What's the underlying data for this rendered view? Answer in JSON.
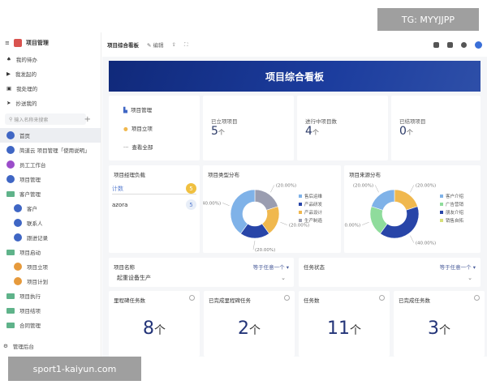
{
  "sidebar": {
    "app_title": "项目管理",
    "quick": [
      {
        "label": "我的待办",
        "icon": "bell-icon"
      },
      {
        "label": "我发起的",
        "icon": "play-icon"
      },
      {
        "label": "我处理的",
        "icon": "inbox-icon"
      },
      {
        "label": "抄送我的",
        "icon": "send-icon"
      }
    ],
    "search_placeholder": "输入名称来搜索",
    "items": [
      {
        "label": "首页",
        "color": "#3f66c4",
        "level": 0,
        "active": true
      },
      {
        "label": "简道云 项目管理「使用说明」",
        "color": "#3f66c4",
        "level": 0
      },
      {
        "label": "员工工作台",
        "color": "#9b4dca",
        "level": 0
      },
      {
        "label": "项目管理",
        "color": "#3f66c4",
        "level": 0
      },
      {
        "label": "客户管理",
        "folder": true,
        "level": 0
      },
      {
        "label": "客户",
        "color": "#3f66c4",
        "level": 1
      },
      {
        "label": "联系人",
        "color": "#3f66c4",
        "level": 1
      },
      {
        "label": "跟进记录",
        "color": "#3f66c4",
        "level": 1
      },
      {
        "label": "项目启动",
        "folder": true,
        "level": 0
      },
      {
        "label": "项目立项",
        "color": "#e69a3c",
        "level": 1
      },
      {
        "label": "项目计划",
        "color": "#e69a3c",
        "level": 1
      },
      {
        "label": "项目执行",
        "folder": true,
        "level": 0
      },
      {
        "label": "项目结项",
        "folder": true,
        "level": 0
      },
      {
        "label": "合同管理",
        "folder": true,
        "level": 0
      }
    ],
    "admin": "管理后台"
  },
  "topbar": {
    "title": "项目综合看板",
    "edit": "编辑"
  },
  "banner": "项目综合看板",
  "shortcuts": [
    "项目管理",
    "项目立项",
    "查看全部"
  ],
  "stats": [
    {
      "label": "已立项项目",
      "value": "5",
      "unit": "个"
    },
    {
      "label": "进行中项目数",
      "value": "4",
      "unit": "个"
    },
    {
      "label": "已结项项目",
      "value": "0",
      "unit": "个"
    }
  ],
  "load": {
    "title": "项目经理负载",
    "header": "计数",
    "header_badge": "5",
    "rows": [
      {
        "name": "azora",
        "value": "5"
      }
    ]
  },
  "chart_data": [
    {
      "type": "pie",
      "title": "项目类型分布",
      "donut": true,
      "categories": [
        "生产制造",
        "产品设计",
        "产品研发",
        "售后运维"
      ],
      "values": [
        20,
        20,
        20,
        40
      ],
      "labels": [
        "(20.00%)",
        "(20.00%)",
        "(20.00%)",
        "40.00%)"
      ],
      "colors": [
        "#9a9db0",
        "#f0b84e",
        "#2845a8",
        "#7fb2e8"
      ],
      "legend": [
        "售后运维",
        "产品研发",
        "产品设计",
        "生产制造"
      ],
      "legend_colors": [
        "#7fb2e8",
        "#2845a8",
        "#f0b84e",
        "#9a9db0"
      ],
      "legend_position": "right"
    },
    {
      "type": "pie",
      "title": "项目来源分布",
      "donut": true,
      "categories": [
        "销售自拓",
        "朋友介绍",
        "广告营销",
        "客户介绍"
      ],
      "values": [
        20,
        40,
        20,
        20
      ],
      "labels": [
        "(20.00%)",
        "(40.00%)",
        "0.00%)",
        "(20.00%)"
      ],
      "colors": [
        "#f0b84e",
        "#2845a8",
        "#8fdc9c",
        "#7fb2e8"
      ],
      "legend": [
        "客户介绍",
        "广告营销",
        "朋友介绍",
        "销售自拓"
      ],
      "legend_colors": [
        "#7fb2e8",
        "#8fdc9c",
        "#2845a8",
        "#d7e07a"
      ],
      "legend_position": "right"
    }
  ],
  "filters": [
    {
      "label": "项目名称",
      "op": "等于任意一个",
      "value": "起重设备生产"
    },
    {
      "label": "任务状态",
      "op": "等于任意一个",
      "value": ""
    }
  ],
  "tasks": [
    {
      "label": "里程碑任务数",
      "value": "8",
      "unit": "个"
    },
    {
      "label": "已完成里程碑任务",
      "value": "2",
      "unit": "个"
    },
    {
      "label": "任务数",
      "value": "11",
      "unit": "个"
    },
    {
      "label": "已完成任务数",
      "value": "3",
      "unit": "个"
    }
  ],
  "watermarks": {
    "top": "TG: MYYJJPP",
    "bottom": "sport1-kaiyun.com"
  }
}
